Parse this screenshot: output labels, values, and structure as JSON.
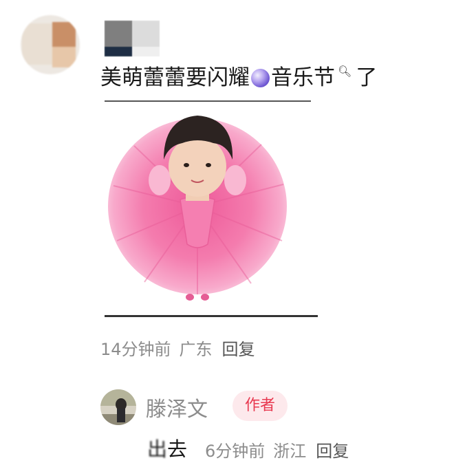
{
  "comment": {
    "text_before": "美萌蕾蕾要闪耀",
    "emoji": "globe-icon",
    "text_after": "音乐节",
    "text_end": "了",
    "time": "14分钟前",
    "location": "广东",
    "reply_label": "回复"
  },
  "reply": {
    "username": "滕泽文",
    "badge": "作者",
    "censored_char": "出",
    "text": "去",
    "time": "6分钟前",
    "location": "浙江",
    "reply_label": "回复"
  },
  "colors": {
    "badge_bg": "#fde9ec",
    "badge_text": "#e8384f",
    "meta_text": "#8c8c8c",
    "tutu_pink": "#f47cae"
  }
}
